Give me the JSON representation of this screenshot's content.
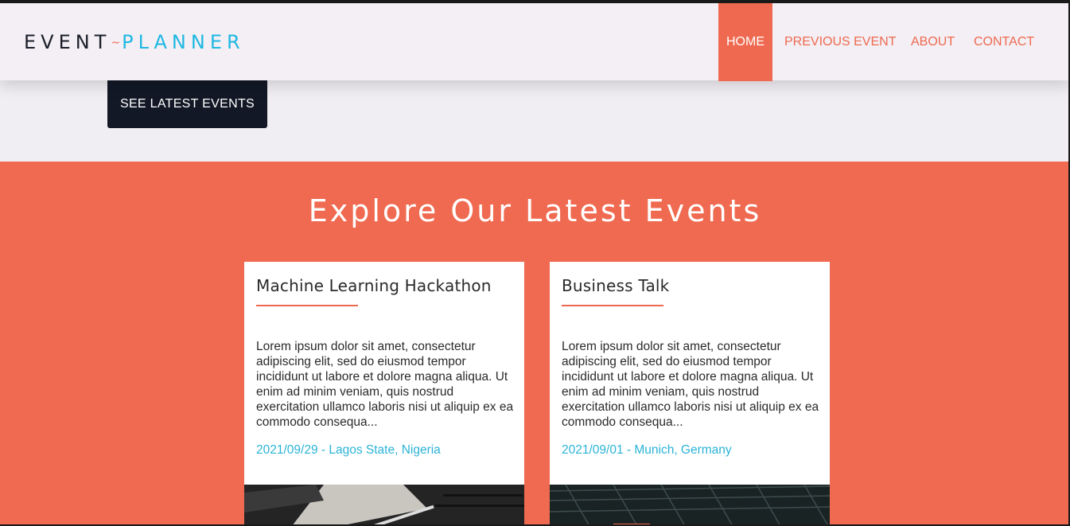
{
  "brand": {
    "part1": "EVENT",
    "separator": "~",
    "part2": "PLANNER"
  },
  "nav": {
    "items": [
      {
        "label": "HOME",
        "active": true
      },
      {
        "label": "PREVIOUS EVENT",
        "active": false
      },
      {
        "label": "ABOUT",
        "active": false
      },
      {
        "label": "CONTACT",
        "active": false
      }
    ]
  },
  "hero": {
    "cta_label": "SEE LATEST EVENTS"
  },
  "events": {
    "title": "Explore Our Latest Events",
    "cards": [
      {
        "title": "Machine Learning Hackathon",
        "body": "Lorem ipsum dolor sit amet, consectetur adipiscing elit, sed do eiusmod tempor incididunt ut labore et dolore magna aliqua. Ut enim ad minim veniam, quis nostrud exercitation ullamco laboris nisi ut aliquip ex ea commodo consequa...",
        "meta": "2021/09/29 - Lagos State, Nigeria"
      },
      {
        "title": "Business Talk",
        "body": "Lorem ipsum dolor sit amet, consectetur adipiscing elit, sed do eiusmod tempor incididunt ut labore et dolore magna aliqua. Ut enim ad minim veniam, quis nostrud exercitation ullamco laboris nisi ut aliquip ex ea commodo consequa...",
        "meta": "2021/09/01 - Munich, Germany"
      }
    ]
  },
  "colors": {
    "accent": "#ef6950",
    "brand_blue": "#1fb8e2",
    "dark": "#121826",
    "background": "#f1eef3"
  }
}
